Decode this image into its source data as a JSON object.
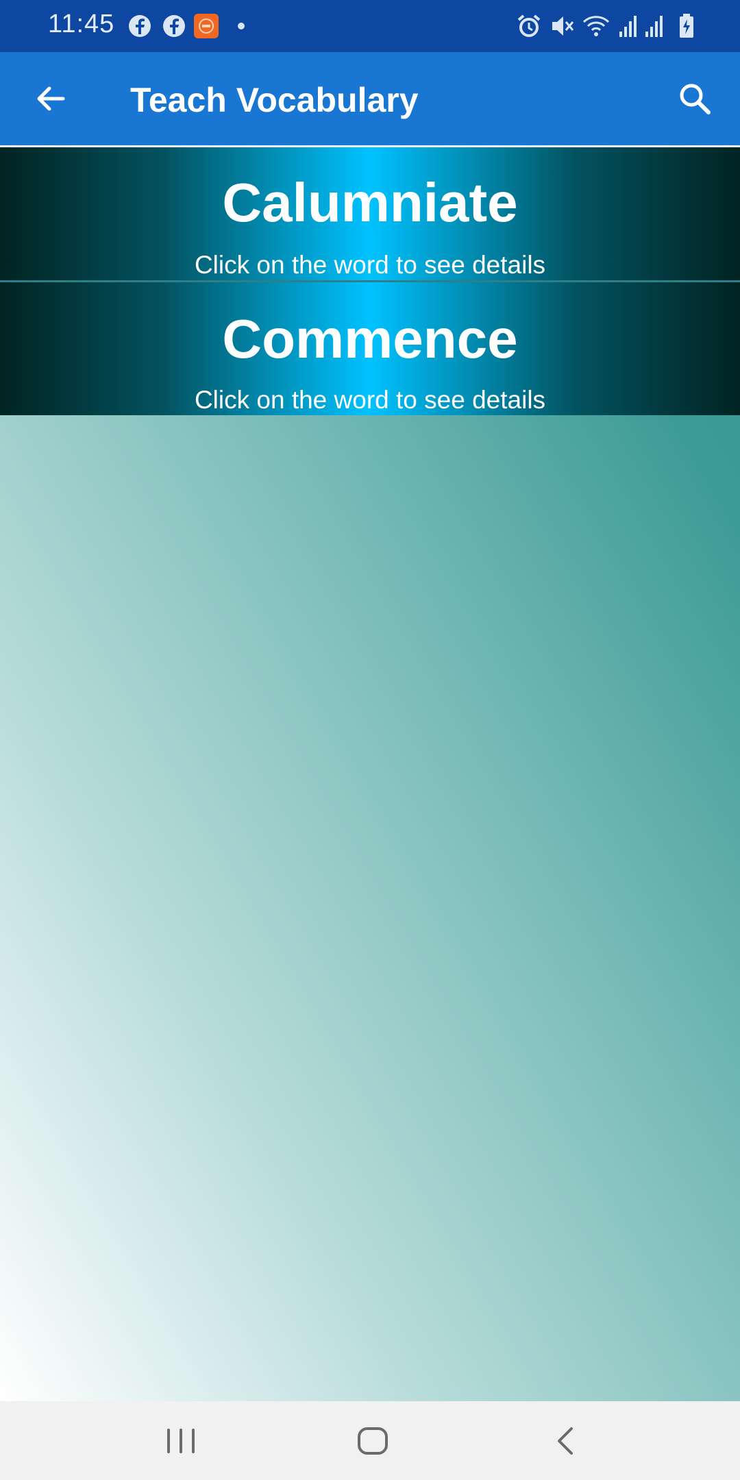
{
  "status_bar": {
    "time": "11:45",
    "left_icons": [
      "facebook-icon",
      "facebook-icon",
      "app-notification-icon",
      "dot-icon"
    ],
    "right_icons": [
      "alarm-icon",
      "mute-icon",
      "wifi-icon",
      "signal-icon",
      "signal-icon",
      "battery-charging-icon"
    ]
  },
  "app_bar": {
    "title": "Teach Vocabulary",
    "back_icon": "arrow-left-icon",
    "search_icon": "search-icon",
    "color": "#1976d2"
  },
  "words": [
    {
      "word": "Calumniate",
      "hint": "Click on the word to see details"
    },
    {
      "word": "Commence",
      "hint": "Click on the word to see details"
    }
  ],
  "nav_bar": {
    "buttons": [
      "recent-apps-icon",
      "home-icon",
      "back-icon"
    ]
  },
  "colors": {
    "status_bar": "#0d47a1",
    "card_center": "#00c2ff",
    "card_edge": "#012322",
    "content_gradient_top": "#319894",
    "content_gradient_bottom": "#ffffff"
  }
}
